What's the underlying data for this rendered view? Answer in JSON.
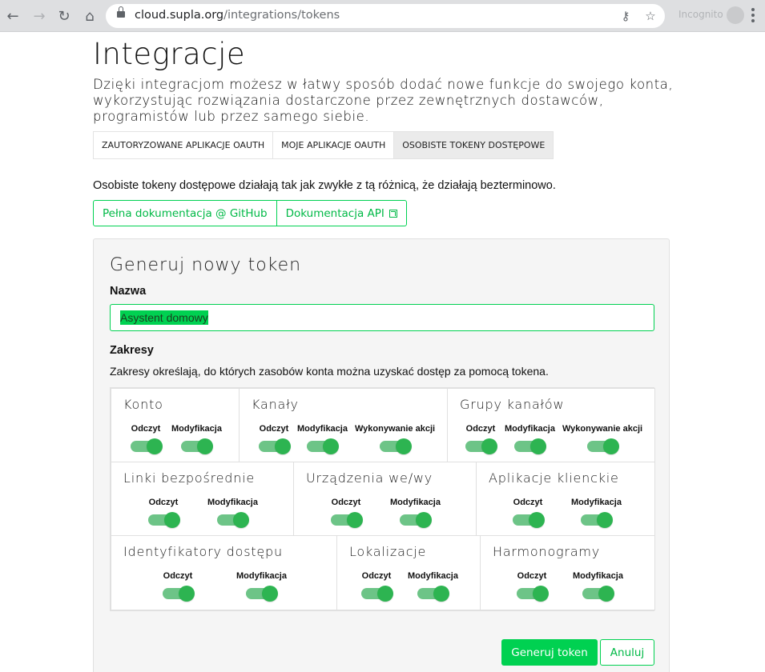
{
  "browser": {
    "url_host": "cloud.supla.org",
    "url_path": "/integrations/tokens",
    "incognito_label": "Incognito"
  },
  "page": {
    "title": "Integracje",
    "intro": "Dzięki integracjom możesz w łatwy sposób dodać nowe funkcje do swojego konta, wykorzystując rozwiązania dostarczone przez zewnętrznych dostawców, programistów lub przez samego siebie."
  },
  "tabs": [
    {
      "label": "ZAUTORYZOWANE APLIKACJE OAUTH",
      "active": false
    },
    {
      "label": "MOJE APLIKACJE OAUTH",
      "active": false
    },
    {
      "label": "OSOBISTE TOKENY DOSTĘPOWE",
      "active": true
    }
  ],
  "tokens": {
    "description": "Osobiste tokeny dostępowe działają tak jak zwykłe z tą różnicą, że działają bezterminowo.",
    "doc_github": "Pełna dokumentacja @ GitHub",
    "doc_api": "Dokumentacja API"
  },
  "form": {
    "title": "Generuj nowy token",
    "name_label": "Nazwa",
    "name_value": "Asystent domowy",
    "scopes_label": "Zakresy",
    "scopes_description": "Zakresy określają, do których zasobów konta można uzyskać dostęp za pomocą tokena.",
    "scopes": [
      {
        "title": "Konto",
        "toggles": [
          {
            "label": "Odczyt",
            "on": true
          },
          {
            "label": "Modyfikacja",
            "on": true
          }
        ]
      },
      {
        "title": "Kanały",
        "toggles": [
          {
            "label": "Odczyt",
            "on": true
          },
          {
            "label": "Modyfikacja",
            "on": true
          },
          {
            "label": "Wykonywanie akcji",
            "on": true
          }
        ]
      },
      {
        "title": "Grupy kanałów",
        "toggles": [
          {
            "label": "Odczyt",
            "on": true
          },
          {
            "label": "Modyfikacja",
            "on": true
          },
          {
            "label": "Wykonywanie akcji",
            "on": true
          }
        ]
      },
      {
        "title": "Linki bezpośrednie",
        "toggles": [
          {
            "label": "Odczyt",
            "on": true
          },
          {
            "label": "Modyfikacja",
            "on": true
          }
        ]
      },
      {
        "title": "Urządzenia we/wy",
        "toggles": [
          {
            "label": "Odczyt",
            "on": true
          },
          {
            "label": "Modyfikacja",
            "on": true
          }
        ]
      },
      {
        "title": "Aplikacje klienckie",
        "toggles": [
          {
            "label": "Odczyt",
            "on": true
          },
          {
            "label": "Modyfikacja",
            "on": true
          }
        ]
      },
      {
        "title": "Identyfikatory dostępu",
        "toggles": [
          {
            "label": "Odczyt",
            "on": true
          },
          {
            "label": "Modyfikacja",
            "on": true
          }
        ]
      },
      {
        "title": "Lokalizacje",
        "toggles": [
          {
            "label": "Odczyt",
            "on": true
          },
          {
            "label": "Modyfikacja",
            "on": true
          }
        ]
      },
      {
        "title": "Harmonogramy",
        "toggles": [
          {
            "label": "Odczyt",
            "on": true
          },
          {
            "label": "Modyfikacja",
            "on": true
          }
        ]
      }
    ],
    "submit_label": "Generuj token",
    "cancel_label": "Anuluj"
  },
  "colors": {
    "accent": "#00d151",
    "toggle_track": "#6dc487",
    "toggle_knob": "#2db451"
  }
}
